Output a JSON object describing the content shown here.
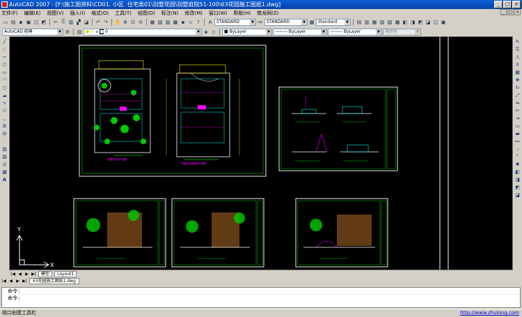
{
  "window": {
    "title": "AutoCAD 2007 - [F:\\施工图资料\\CD01. 小区. 住宅类01\\别墅花园\\别墅庭院51-100\\63花园施工图纸1.dwg]",
    "buttons": [
      "_",
      "□",
      "×"
    ]
  },
  "menu": [
    "文件(F)",
    "编辑(E)",
    "视图(V)",
    "插入(I)",
    "格式(O)",
    "工具(T)",
    "绘图(D)",
    "标注(N)",
    "修改(M)",
    "窗口(W)",
    "帮助(H)",
    "筑龙网(Z)"
  ],
  "toolbar": {
    "text_style": "STANDARD",
    "dim_style": "STANDARD",
    "table_style": "Standard",
    "workspace": "AutoCAD 经典",
    "layer": "0",
    "color": "ByLayer",
    "linetype": "ByLayer",
    "lineweight": "ByLayer",
    "plotstyle": "随颜色"
  },
  "icons": {
    "draw_left": [
      "line-icon",
      "polyline-icon",
      "xline-icon",
      "polygon-icon",
      "rectangle-icon",
      "arc-icon",
      "circle-icon",
      "revcloud-icon",
      "spline-icon",
      "ellipse-icon",
      "ellipse-arc-icon",
      "insert-block-icon",
      "make-block-icon",
      "point-icon",
      "hatch-icon",
      "gradient-icon",
      "region-icon",
      "table-icon",
      "mtext-icon"
    ],
    "modify_right": [
      "erase-icon",
      "copy-icon",
      "mirror-icon",
      "offset-icon",
      "array-icon",
      "move-icon",
      "rotate-icon",
      "scale-icon",
      "stretch-icon",
      "trim-icon",
      "extend-icon",
      "break-point-icon",
      "break-icon",
      "join-icon",
      "chamfer-icon",
      "fillet-icon",
      "explode-icon"
    ]
  },
  "drawing": {
    "plan_labels": [
      "别墅花园平面图",
      "别墅花园铺装平面图"
    ],
    "ucs_x": "X",
    "ucs_y": "Y"
  },
  "layout_tabs": [
    "模型",
    "Layout1"
  ],
  "doc_tab": "63花园施工图纸1.dwg",
  "command": {
    "line1": "命令:",
    "line2": "命令:"
  },
  "status": {
    "left": "视口创建工具栏",
    "watermark": "http://www.zhulong.com"
  }
}
